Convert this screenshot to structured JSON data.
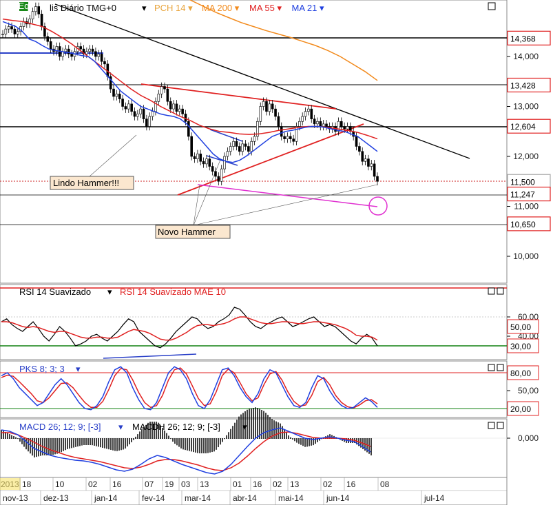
{
  "header": {
    "badge": "Eq",
    "title_fragment": "lis Diário TMG+0",
    "indicators": [
      {
        "label": "PCH 14",
        "color": "#e8a33a"
      },
      {
        "label": "MA 200",
        "color": "#f28a1c"
      },
      {
        "label": "MA 55",
        "color": "#e02020"
      },
      {
        "label": "MA 21",
        "color": "#2040e0"
      }
    ]
  },
  "price_axis": {
    "ticks": [
      "14,000",
      "13,000",
      "12,000",
      "11,000",
      "10,000"
    ],
    "tags": [
      {
        "label": "14,368",
        "border": "#e02020"
      },
      {
        "label": "13,428",
        "border": "#e02020"
      },
      {
        "label": "12,604",
        "border": "#e02020"
      },
      {
        "label": "11,500",
        "border": "#aaaaaa"
      },
      {
        "label": "11,247",
        "border": "#e02020"
      },
      {
        "label": "10,650",
        "border": "#e02020"
      }
    ]
  },
  "annotations": {
    "lindo_hammer": "Lindo Hammer!!!",
    "novo_hammer": "Novo Hammer"
  },
  "rsi_panel": {
    "title": "RSI 14 Suavizado",
    "title2": "RSI 14 Suavizado MAE 10",
    "ticks": [
      "60,00",
      "40,00"
    ],
    "tags": [
      "50,00",
      "30,00"
    ]
  },
  "pks_panel": {
    "title": "PKS 8; 3; 3",
    "ticks": [
      "50,00"
    ],
    "tags": [
      "80,00",
      "20,00"
    ]
  },
  "macd_panel": {
    "title": "MACD 26; 12; 9; [-3]",
    "title2": "MACDH 26; 12; 9; [-3]",
    "ticks": [
      "0,000"
    ]
  },
  "date_axis": {
    "days": [
      "2013",
      "18",
      "10",
      "02",
      "16",
      "07",
      "19",
      "03",
      "13",
      "01",
      "16",
      "02",
      "13",
      "02",
      "16",
      "08"
    ],
    "months": [
      "nov-13",
      "dez-13",
      "jan-14",
      "fev-14",
      "mar-14",
      "abr-14",
      "mai-14",
      "jun-14",
      "jul-14"
    ]
  },
  "chart_data": {
    "type": "line",
    "price_closes": [
      14.45,
      14.55,
      14.6,
      14.55,
      14.45,
      14.5,
      14.6,
      14.7,
      14.65,
      14.75,
      14.9,
      15.0,
      14.85,
      14.6,
      14.4,
      14.3,
      14.15,
      14.1,
      14.2,
      14.0,
      14.1,
      14.15,
      14.05,
      14.0,
      14.1,
      14.2,
      14.15,
      14.05,
      14.1,
      14.15,
      14.1,
      14.0,
      14.05,
      13.9,
      13.85,
      13.6,
      13.35,
      13.2,
      13.25,
      13.15,
      13.0,
      12.95,
      13.05,
      12.9,
      12.8,
      12.85,
      12.95,
      12.75,
      12.6,
      12.8,
      12.9,
      13.1,
      13.25,
      13.4,
      13.35,
      13.1,
      12.95,
      13.05,
      12.9,
      12.95,
      12.85,
      12.7,
      12.4,
      12.0,
      11.95,
      12.05,
      11.9,
      11.85,
      11.95,
      11.8,
      11.7,
      11.6,
      11.5,
      11.75,
      12.0,
      12.1,
      12.2,
      12.3,
      12.2,
      12.1,
      12.25,
      12.2,
      12.1,
      12.3,
      12.4,
      12.7,
      13.0,
      13.1,
      12.9,
      13.05,
      12.95,
      12.8,
      12.6,
      12.4,
      12.35,
      12.4,
      12.35,
      12.3,
      12.6,
      12.7,
      12.8,
      12.9,
      12.95,
      12.75,
      12.65,
      12.7,
      12.6,
      12.65,
      12.6,
      12.55,
      12.6,
      12.5,
      12.7,
      12.6,
      12.55,
      12.6,
      12.5,
      12.4,
      12.2,
      12.1,
      11.9,
      11.95,
      11.8,
      11.85,
      11.6,
      11.5
    ],
    "ma21": [
      14.7,
      14.65,
      14.6,
      14.5,
      14.35,
      14.3,
      14.22,
      14.15,
      14.12,
      14.1,
      14.08,
      14.05,
      14.02,
      14.0,
      13.9,
      13.75,
      13.6,
      13.45,
      13.3,
      13.2,
      13.1,
      13.0,
      12.95,
      12.9,
      12.85,
      12.82,
      12.8,
      12.75,
      12.65,
      12.5,
      12.35,
      12.2,
      12.05,
      11.95,
      11.9,
      11.88,
      11.92,
      12.0,
      12.1,
      12.2,
      12.3,
      12.4,
      12.45,
      12.5,
      12.52,
      12.55,
      12.58,
      12.6,
      12.6,
      12.58,
      12.55,
      12.52,
      12.5,
      12.45,
      12.4,
      12.3,
      12.2,
      12.1
    ],
    "ma55": [
      14.75,
      14.72,
      14.7,
      14.65,
      14.6,
      14.5,
      14.38,
      14.25,
      14.1,
      13.95,
      13.8,
      13.65,
      13.5,
      13.35,
      13.22,
      13.12,
      13.0,
      12.9,
      12.8,
      12.72,
      12.62,
      12.55,
      12.5,
      12.48,
      12.45,
      12.44,
      12.45,
      12.48,
      12.52,
      12.55,
      12.58,
      12.6,
      12.6,
      12.58,
      12.55,
      12.52,
      12.48,
      12.42,
      12.35
    ],
    "ma200": [
      15.7,
      15.6,
      15.5,
      15.38,
      15.25,
      15.12,
      15.0,
      14.88,
      14.78,
      14.68,
      14.6,
      14.52,
      14.45,
      14.38,
      14.3,
      14.22,
      14.12,
      14.0,
      13.85,
      13.7,
      13.52
    ],
    "x_labels_months": [
      "nov-13",
      "dez-13",
      "jan-14",
      "fev-14",
      "mar-14",
      "abr-14",
      "mai-14",
      "jun-14",
      "jul-14"
    ],
    "y_ticks": [
      14,
      13,
      12,
      11,
      10
    ],
    "price_levels": [
      14.368,
      13.428,
      12.604,
      11.5,
      11.247,
      10.65
    ],
    "rsi": [
      55,
      58,
      52,
      48,
      45,
      50,
      55,
      48,
      40,
      35,
      42,
      50,
      45,
      38,
      30,
      32,
      35,
      40,
      42,
      38,
      35,
      40,
      45,
      52,
      58,
      55,
      45,
      40,
      35,
      30,
      28,
      32,
      38,
      45,
      50,
      55,
      60,
      58,
      52,
      48,
      50,
      55,
      58,
      62,
      70,
      68,
      62,
      55,
      50,
      48,
      52,
      55,
      58,
      60,
      55,
      50,
      52,
      55,
      58,
      60,
      55,
      50,
      52,
      50,
      45,
      40,
      35,
      32,
      38,
      42,
      38,
      30
    ],
    "rsi_ma": [
      55,
      55,
      54,
      52,
      50,
      49,
      50,
      49,
      47,
      45,
      44,
      45,
      45,
      43,
      41,
      39,
      38,
      38,
      39,
      39,
      38,
      38,
      39,
      42,
      45,
      47,
      46,
      45,
      43,
      40,
      37,
      36,
      36,
      38,
      41,
      44,
      48,
      51,
      52,
      52,
      51,
      52,
      53,
      55,
      58,
      60,
      60,
      58,
      56,
      54,
      53,
      53,
      54,
      55,
      55,
      54,
      53,
      53,
      54,
      55,
      55,
      54,
      53,
      52,
      50,
      48,
      45,
      41,
      40,
      40,
      39,
      36
    ],
    "pks_k": [
      75,
      80,
      70,
      55,
      45,
      35,
      25,
      30,
      45,
      60,
      70,
      60,
      45,
      30,
      20,
      18,
      25,
      40,
      65,
      85,
      90,
      80,
      55,
      35,
      20,
      18,
      30,
      55,
      80,
      90,
      85,
      70,
      45,
      25,
      20,
      35,
      60,
      85,
      88,
      75,
      55,
      40,
      30,
      45,
      70,
      85,
      80,
      60,
      40,
      25,
      22,
      30,
      55,
      75,
      70,
      50,
      35,
      25,
      20,
      22,
      30,
      38,
      32,
      22
    ],
    "pks_d": [
      72,
      76,
      74,
      65,
      55,
      45,
      33,
      30,
      38,
      50,
      62,
      63,
      55,
      42,
      30,
      22,
      22,
      32,
      52,
      75,
      87,
      85,
      68,
      47,
      30,
      22,
      25,
      42,
      68,
      85,
      88,
      78,
      58,
      37,
      25,
      28,
      48,
      75,
      86,
      80,
      63,
      45,
      33,
      38,
      60,
      78,
      82,
      68,
      48,
      32,
      24,
      26,
      42,
      65,
      72,
      60,
      42,
      30,
      23,
      21,
      26,
      33,
      35,
      28
    ],
    "macd": [
      0.12,
      0.1,
      0.05,
      -0.05,
      -0.15,
      -0.2,
      -0.25,
      -0.28,
      -0.3,
      -0.32,
      -0.33,
      -0.35,
      -0.38,
      -0.42,
      -0.46,
      -0.48,
      -0.45,
      -0.38,
      -0.3,
      -0.25,
      -0.28,
      -0.33,
      -0.38,
      -0.42,
      -0.46,
      -0.5,
      -0.52,
      -0.48,
      -0.38,
      -0.25,
      -0.12,
      0.0,
      0.08,
      0.12,
      0.15,
      0.1,
      0.05,
      0.0,
      -0.02,
      0.0,
      0.02,
      0.0,
      -0.03,
      -0.05,
      -0.12,
      -0.2
    ],
    "macd_signal": [
      0.08,
      0.08,
      0.05,
      0.0,
      -0.06,
      -0.12,
      -0.17,
      -0.21,
      -0.25,
      -0.28,
      -0.3,
      -0.32,
      -0.34,
      -0.37,
      -0.4,
      -0.43,
      -0.44,
      -0.42,
      -0.38,
      -0.33,
      -0.31,
      -0.31,
      -0.33,
      -0.36,
      -0.39,
      -0.43,
      -0.46,
      -0.47,
      -0.43,
      -0.36,
      -0.26,
      -0.15,
      -0.05,
      0.03,
      0.08,
      0.09,
      0.07,
      0.04,
      0.01,
      0.0,
      0.0,
      0.0,
      -0.01,
      -0.03,
      -0.07,
      -0.12
    ]
  }
}
